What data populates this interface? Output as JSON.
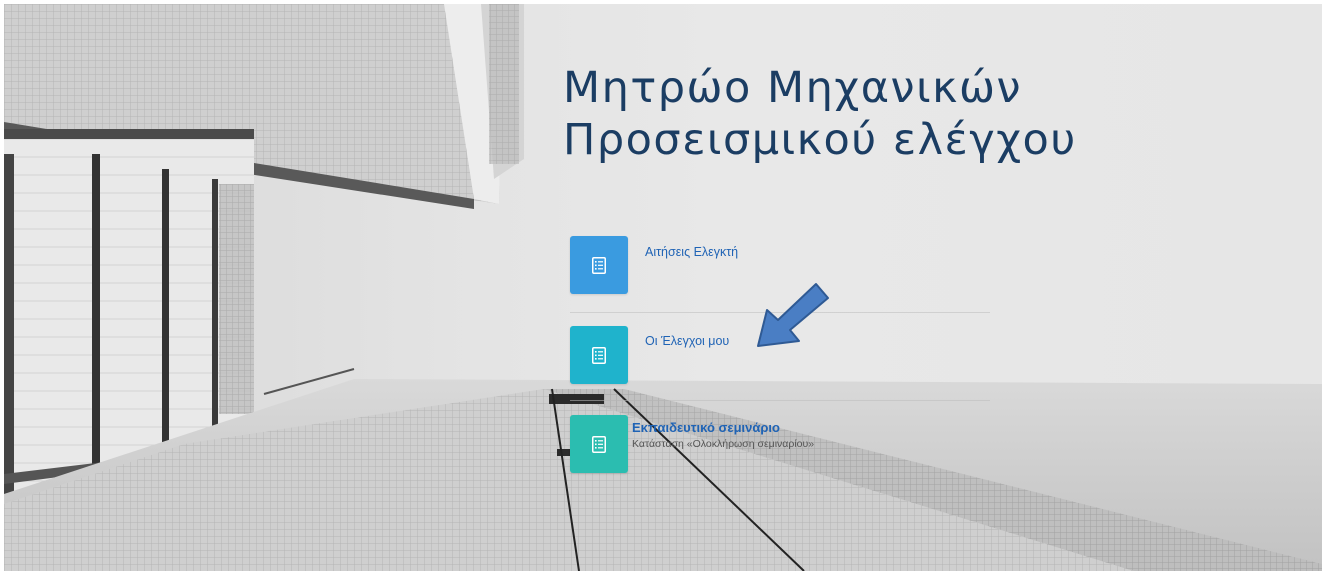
{
  "header": {
    "title_line1": "Μητρώο Μηχανικών",
    "title_line2": "Προσεισμικού ελέγχου",
    "title_color": "#1b3d63"
  },
  "menu": {
    "items": [
      {
        "label": "Αιτήσεις Ελεγκτή",
        "icon": "document-list-icon",
        "color": "#3a9be0"
      },
      {
        "label": "Οι Έλεγχοι μου",
        "icon": "document-list-icon",
        "color": "#1fb3cc"
      },
      {
        "label": "Εκπαιδευτικό σεμινάριο",
        "sublabel": "Κατάσταση «Ολοκλήρωση σεμιναρίου»",
        "icon": "document-list-icon",
        "color": "#2bbdb0"
      }
    ],
    "link_color": "#1f63b5"
  },
  "annotation": {
    "icon": "arrow-pointer-icon",
    "color": "#4a7ec4"
  }
}
